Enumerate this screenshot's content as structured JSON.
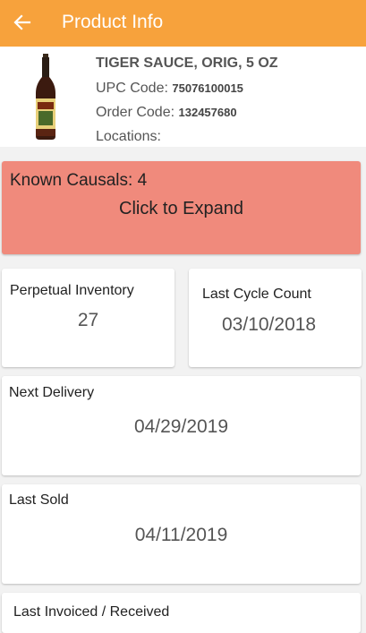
{
  "appbar": {
    "title": "Product Info",
    "back_icon": "arrow-left-icon"
  },
  "product": {
    "name": "TIGER SAUCE, ORIG, 5 OZ",
    "upc_label": "UPC Code:",
    "upc_value": "75076100015",
    "order_label": "Order Code:",
    "order_value": "132457680",
    "locations_label": "Locations:"
  },
  "causals": {
    "label": "Known Causals: 4",
    "expand": "Click to Expand"
  },
  "cards": {
    "perpetual_inventory": {
      "title": "Perpetual Inventory",
      "value": "27"
    },
    "last_cycle_count": {
      "title": "Last Cycle Count",
      "value": "03/10/2018"
    },
    "next_delivery": {
      "title": "Next Delivery",
      "value": "04/29/2019"
    },
    "last_sold": {
      "title": "Last Sold",
      "value": "04/11/2019"
    },
    "last_invoiced": {
      "title": "Last Invoiced / Received"
    }
  },
  "colors": {
    "appbar": "#f7a23c",
    "causals_bg": "#f08a7c"
  }
}
